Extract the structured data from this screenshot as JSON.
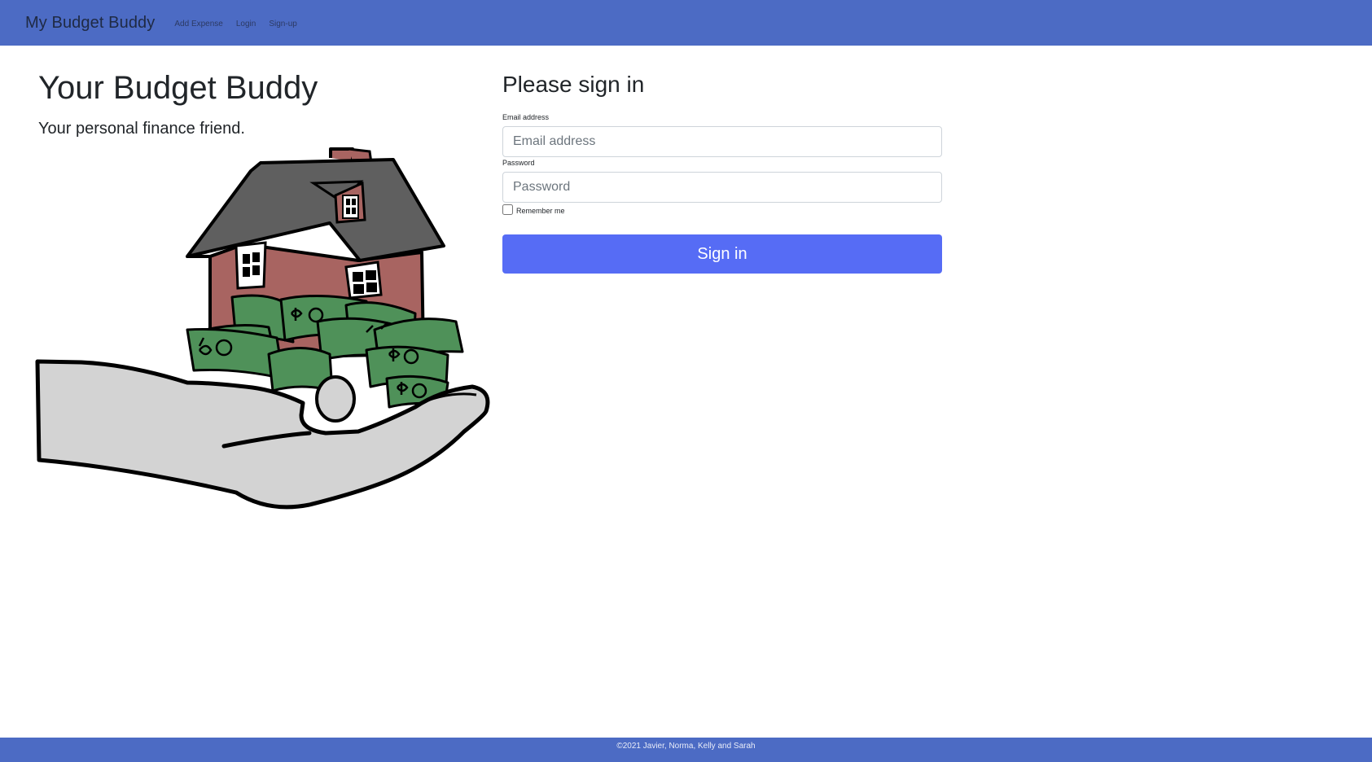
{
  "navbar": {
    "brand": "My Budget Buddy",
    "links": [
      "Add Expense",
      "Login",
      "Sign-up"
    ]
  },
  "hero": {
    "title": "Your Budget Buddy",
    "subtitle": "Your personal finance friend."
  },
  "signin": {
    "heading": "Please sign in",
    "email_label": "Email address",
    "email_placeholder": "Email address",
    "password_label": "Password",
    "password_placeholder": "Password",
    "remember_label": "Remember me",
    "button_label": "Sign in"
  },
  "footer": {
    "text": "©2021 Javier, Norma, Kelly and Sarah"
  },
  "colors": {
    "navbar": "#4c6bc4",
    "button": "#566cf5",
    "house_wall": "#a86461",
    "roof": "#5f5f5f",
    "money": "#4f9159",
    "hand": "#d3d3d3"
  }
}
